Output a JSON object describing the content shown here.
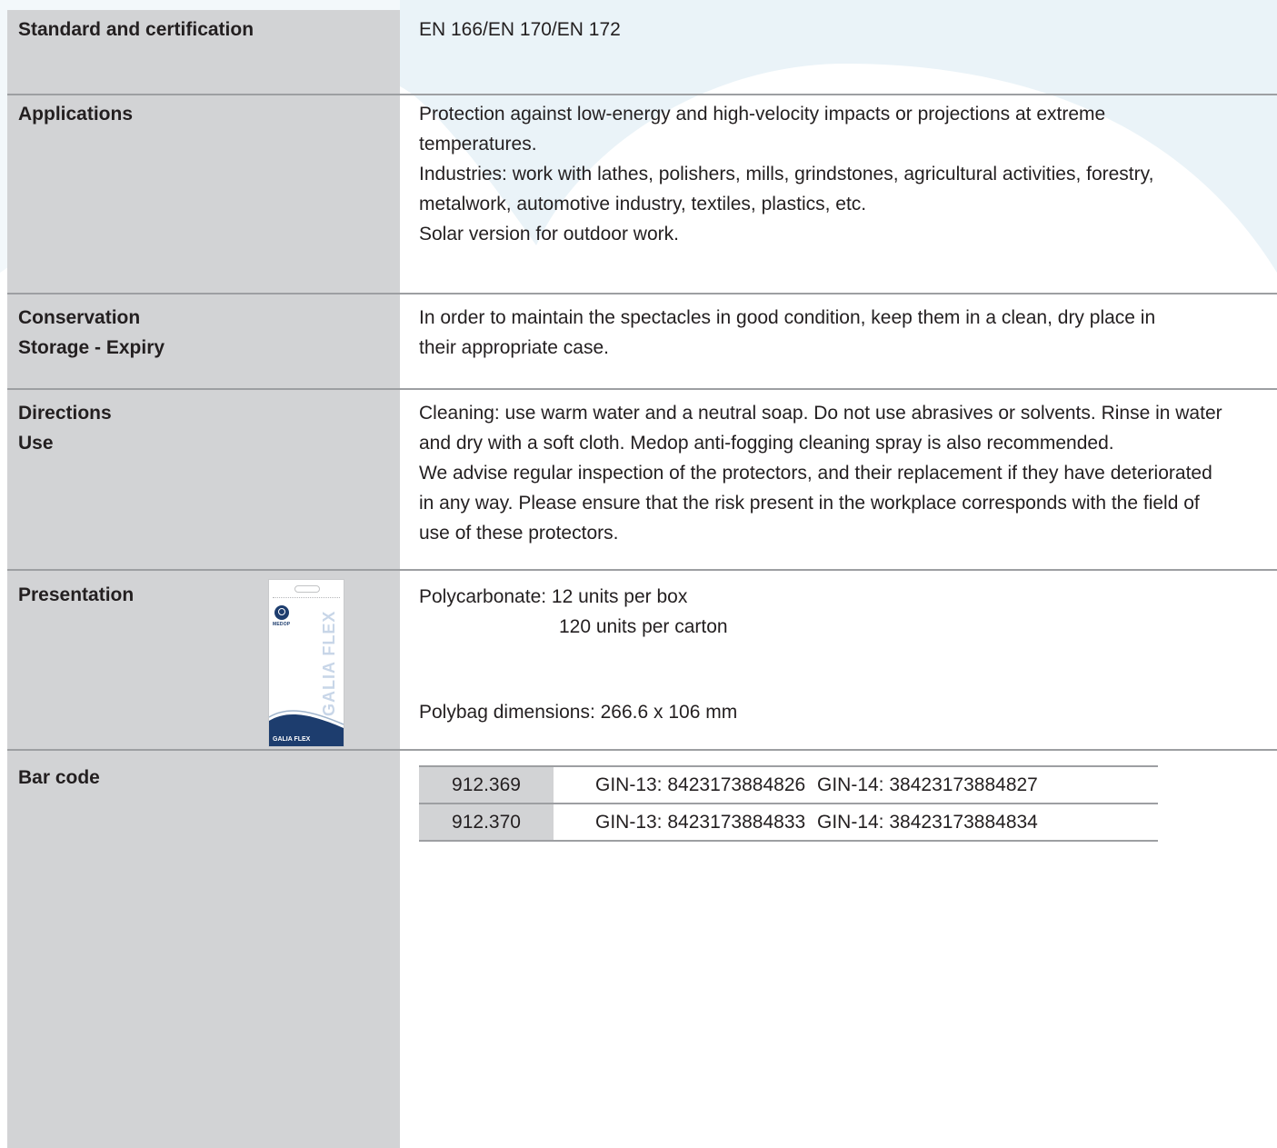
{
  "rows": {
    "standard": {
      "label": "Standard and certification",
      "value": "EN 166/EN 170/EN 172"
    },
    "applications": {
      "label": "Applications",
      "lines": [
        "Protection against low-energy and high-velocity impacts or projections at extreme",
        "temperatures.",
        "Industries: work with lathes, polishers, mills, grindstones, agricultural activities, forestry,",
        "metalwork, automotive industry, textiles, plastics, etc.",
        "Solar version for outdoor work."
      ]
    },
    "conservation": {
      "label_line1": "Conservation",
      "label_line2": "Storage - Expiry",
      "lines": [
        "In order to maintain the spectacles in good condition, keep them in a clean, dry place in",
        "their appropriate case."
      ]
    },
    "directions": {
      "label_line1": "Directions",
      "label_line2": "Use",
      "lines": [
        "Cleaning: use warm water and a neutral soap. Do not use abrasives or solvents. Rinse in water",
        "and dry with a soft cloth. Medop anti-fogging cleaning spray is also recommended.",
        "We advise regular inspection of the protectors, and their replacement if they have deteriorated",
        "in any way. Please ensure that the risk present in the workplace corresponds with the field of",
        "use of these protectors."
      ]
    },
    "presentation": {
      "label": "Presentation",
      "line1": "Polycarbonate: 12 units per box",
      "line2": "120 units per carton",
      "line3": "Polybag dimensions: 266.6 x 106 mm",
      "package": {
        "brand": "MEDOP",
        "vertical_name": "GALIA FLEX",
        "bottom_name": "GALIA FLEX"
      }
    },
    "barcode": {
      "label": "Bar code",
      "items": [
        {
          "code": "912.369",
          "gin13": "GIN-13: 8423173884826",
          "gin14": "GIN-14: 38423173884827"
        },
        {
          "code": "912.370",
          "gin13": "GIN-13: 8423173884833",
          "gin14": "GIN-14: 38423173884834"
        }
      ]
    }
  },
  "colors": {
    "label_column": "#d2d3d5",
    "divider": "#9d9fa2",
    "background_wave": "#eaf3f8",
    "text": "#231f20",
    "brand_blue": "#1d3d6e"
  }
}
